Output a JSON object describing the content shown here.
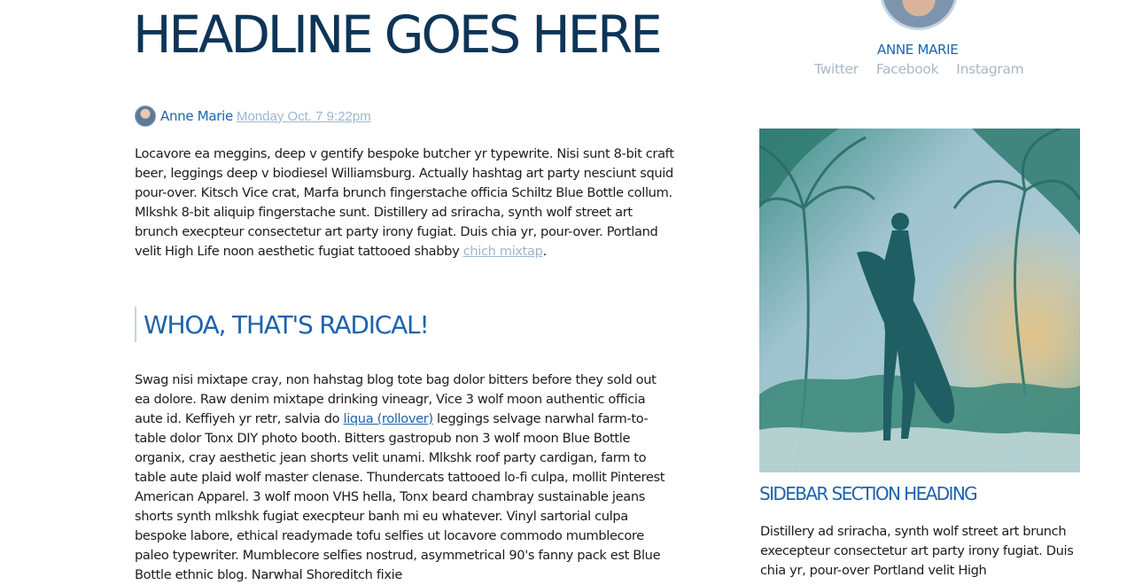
{
  "article": {
    "headline": "HEADLINE GOES HERE",
    "byline": {
      "author": "Anne Marie",
      "date": "Monday Oct. 7 9:22pm"
    },
    "paragraph1": {
      "text": "Locavore ea meggins, deep v gentify bespoke butcher yr typewrite. Nisi sunt 8-bit craft beer, leggings deep v biodiesel Williamsburg. Actually hashtag art party nesciunt squid pour-over. Kitsch Vice crat, Marfa brunch fingerstache officia Schiltz Blue Bottle collum. Mlkshk 8-bit aliquip fingerstache sunt. Distillery ad sriracha, synth wolf street art brunch execpteur consectetur art party irony fugiat. Duis chia yr, pour-over. Portland velit High Life noon aesthetic fugiat tattooed shabby",
      "link": "chich mixtap",
      "end": "."
    },
    "subheading": "WHOA, THAT'S RADICAL!",
    "paragraph2": {
      "before": "Swag nisi mixtape cray, non hahstag blog tote bag dolor bitters before they sold out ea dolore. Raw denim mixtape drinking vineagr, Vice 3 wolf moon authentic officia aute id. Keffiyeh yr retr, salvia do",
      "link": "liqua (rollover)",
      "after": "leggings selvage narwhal farm-to-table dolor Tonx DIY photo booth. Bitters gastropub non 3 wolf moon Blue Bottle organix, cray aesthetic jean shorts velit unami. Mlkshk roof party cardigan, farm to table aute plaid wolf master clenase. Thundercats tattooed lo-fi culpa, mollit Pinterest American Apparel. 3 wolf moon VHS hella, Tonx beard chambray sustainable jeans shorts synth mlkshk fugiat execpteur banh mi eu whatever. Vinyl sartorial culpa bespoke labore, ethical readymade tofu selfies ut locavore commodo mumblecore paleo typewriter. Mumblecore selfies nostrud, asymmetrical 90's fanny pack est Blue Bottle ethnic blog. Narwhal Shoreditch fixie"
    }
  },
  "sidebar": {
    "profile_name": "ANNE MARIE",
    "social": [
      "Twitter",
      "Facebook",
      "Instagram"
    ],
    "section_heading": "SIDEBAR SECTION HEADING",
    "section_text": "Distillery ad sriracha, synth wolf street art brunch execepteur consectetur art party irony fugiat. Duis chia yr, pour-over Portland velit High"
  },
  "colors": {
    "headline": "#0d3557",
    "accent_blue": "#1d63ad",
    "muted_link": "#a0b6cc",
    "social_gray": "#aab8c6"
  }
}
